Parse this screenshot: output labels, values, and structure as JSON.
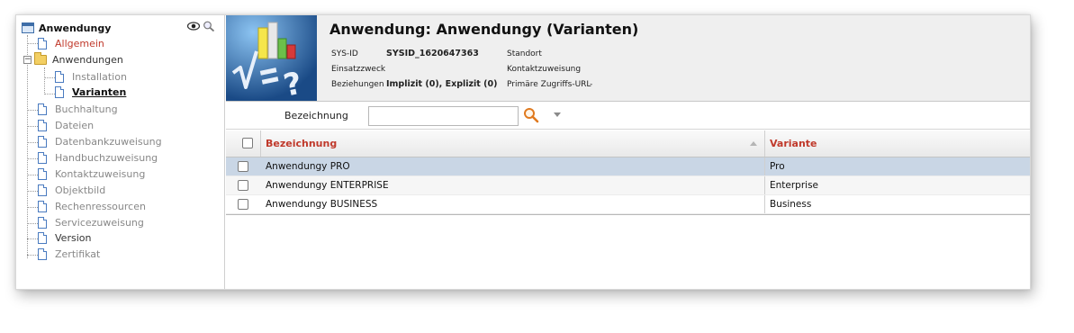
{
  "sidebar": {
    "root_label": "Anwendungy",
    "items": [
      {
        "label": "Allgemein",
        "state": "active"
      },
      {
        "label": "Anwendungen",
        "state": "normal"
      },
      {
        "label": "Installation",
        "state": "muted"
      },
      {
        "label": "Varianten",
        "state": "selected"
      },
      {
        "label": "Buchhaltung",
        "state": "muted"
      },
      {
        "label": "Dateien",
        "state": "muted"
      },
      {
        "label": "Datenbankzuweisung",
        "state": "muted"
      },
      {
        "label": "Handbuchzuweisung",
        "state": "muted"
      },
      {
        "label": "Kontaktzuweisung",
        "state": "muted"
      },
      {
        "label": "Objektbild",
        "state": "muted"
      },
      {
        "label": "Rechenressourcen",
        "state": "muted"
      },
      {
        "label": "Servicezuweisung",
        "state": "muted"
      },
      {
        "label": "Version",
        "state": "normal"
      },
      {
        "label": "Zertifikat",
        "state": "muted"
      }
    ]
  },
  "header": {
    "title": "Anwendung: Anwendungy (Varianten)",
    "sysid_label": "SYS-ID",
    "sysid_value": "SYSID_1620647363",
    "einsatzzweck_label": "Einsatzzweck",
    "beziehungen_label": "Beziehungen",
    "beziehungen_value": "Implizit (0), Explizit (0)",
    "standort_label": "Standort",
    "kontakt_label": "Kontaktzuweisung",
    "url_label": "Primäre Zugriffs-URL",
    "url_value": "-"
  },
  "filter": {
    "label": "Bezeichnung",
    "value": ""
  },
  "table": {
    "columns": [
      "Bezeichnung",
      "Variante"
    ],
    "rows": [
      {
        "bezeichnung": "Anwendungy PRO",
        "variante": "Pro"
      },
      {
        "bezeichnung": "Anwendungy ENTERPRISE",
        "variante": "Enterprise"
      },
      {
        "bezeichnung": "Anwendungy BUSINESS",
        "variante": "Business"
      }
    ]
  },
  "colors": {
    "accent_red": "#c0392b",
    "selection_blue": "#c9d6e5",
    "header_gray": "#efefef"
  },
  "icons": {
    "root": "window-icon",
    "view": "eye-icon",
    "search": "magnifier-icon",
    "item": "document-icon",
    "group": "folder-icon",
    "logo": "application-logo"
  }
}
